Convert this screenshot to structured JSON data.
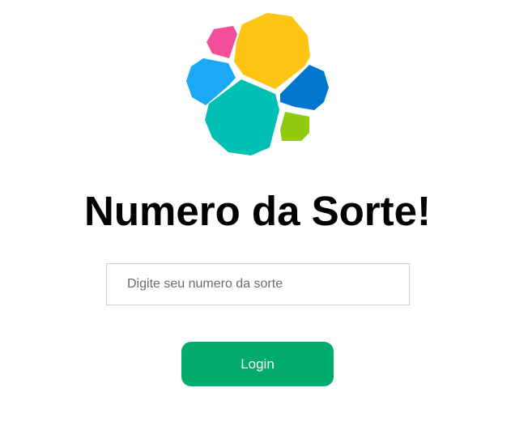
{
  "page": {
    "title": "Numero da Sorte!"
  },
  "logo": {
    "icon": "elastic-logo-icon",
    "colors": {
      "pink": "#F04E98",
      "yellow": "#FEC514",
      "light_blue": "#1BA9F5",
      "dark_blue": "#0077CC",
      "teal": "#00BFB3",
      "green": "#93C90E"
    }
  },
  "form": {
    "input_placeholder": "Digite seu numero da sorte",
    "input_value": "",
    "login_label": "Login"
  },
  "colors": {
    "button": "#03AB6E",
    "input_border": "#CFCFCF"
  }
}
